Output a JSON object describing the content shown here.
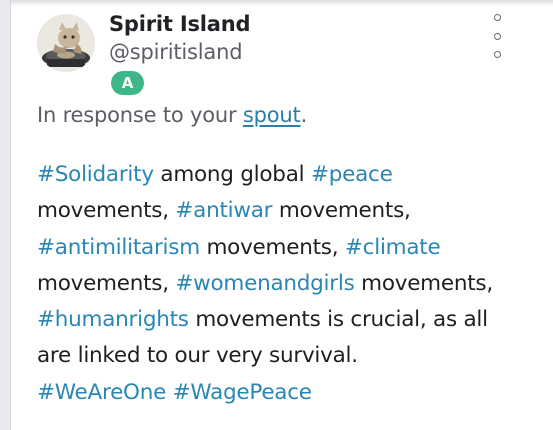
{
  "post": {
    "author_name": "Spirit Island",
    "author_handle": "@spiritisland",
    "badge": "A",
    "reply_prefix": "In response to your ",
    "reply_link": "spout",
    "reply_suffix": ".",
    "body_lines": [
      [
        {
          "text": "#Solidarity",
          "tag": true
        },
        {
          "text": " among global ",
          "tag": false
        },
        {
          "text": "#peace",
          "tag": true
        }
      ],
      [
        {
          "text": "movements, ",
          "tag": false
        },
        {
          "text": "#antiwar",
          "tag": true
        },
        {
          "text": " movements,",
          "tag": false
        }
      ],
      [
        {
          "text": "#antimilitarism",
          "tag": true
        },
        {
          "text": " movements, ",
          "tag": false
        },
        {
          "text": "#climate",
          "tag": true
        }
      ],
      [
        {
          "text": "movements, ",
          "tag": false
        },
        {
          "text": "#womenandgirls",
          "tag": true
        },
        {
          "text": " movements,",
          "tag": false
        }
      ],
      [
        {
          "text": "#humanrights",
          "tag": true
        },
        {
          "text": " movements is crucial, as all",
          "tag": false
        }
      ],
      [
        {
          "text": "are linked to our very survival.",
          "tag": false
        }
      ],
      [
        {
          "text": "#WeAreOne",
          "tag": true
        },
        {
          "text": " ",
          "tag": false
        },
        {
          "text": "#WagePeace",
          "tag": true
        }
      ]
    ]
  },
  "colors": {
    "hashtag": "#2a86b3",
    "link": "#2a7fa8",
    "badge": "#3fb68a"
  },
  "icons": {
    "menu": "more-vertical-icon",
    "avatar": "avatar-image"
  }
}
